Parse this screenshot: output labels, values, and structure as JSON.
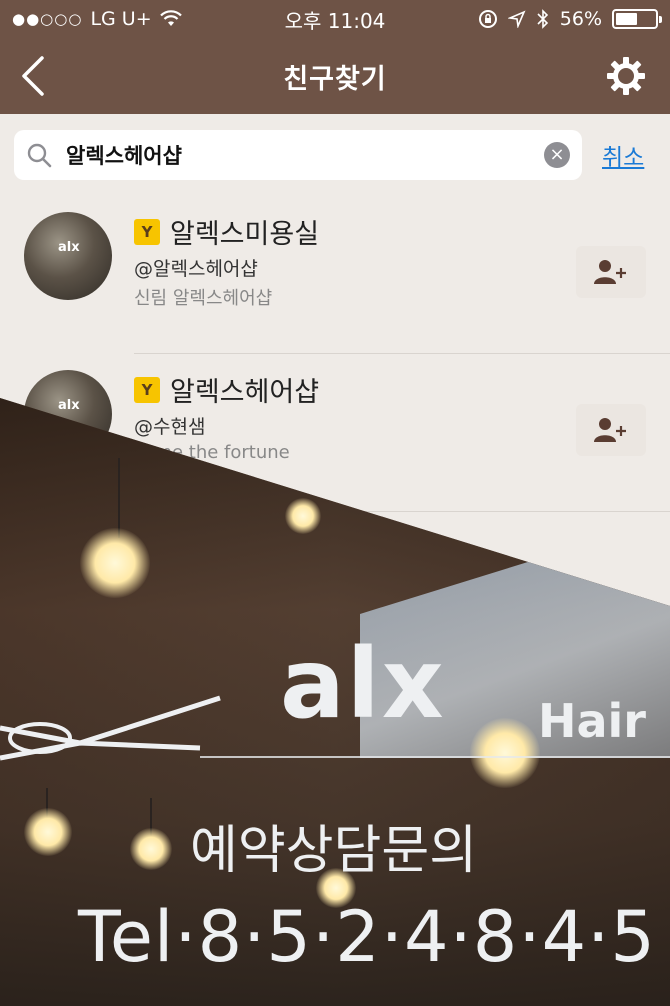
{
  "status": {
    "carrier": "LG U+",
    "time": "오후 11:04",
    "battery": "56%",
    "battery_level": 0.56
  },
  "nav": {
    "title": "친구찾기"
  },
  "search": {
    "value": "알렉스헤어샵",
    "cancel_label": "취소"
  },
  "results": [
    {
      "badge": "Y",
      "name": "알렉스미용실",
      "handle": "@알렉스헤어샵",
      "desc": "신림 알렉스헤어샵"
    },
    {
      "badge": "Y",
      "name": "알렉스헤어샵",
      "handle": "@수현샘",
      "desc": "w me the fortune"
    }
  ],
  "photo": {
    "logo_alx": "alx",
    "logo_hair": "Hair",
    "reservation": "예약상담문의",
    "tel": "Tel·8·5·2·4·8·4·5"
  },
  "colors": {
    "header_bg": "#6e5346",
    "page_bg": "#efebe7",
    "badge_yellow": "#f7c400",
    "link_blue": "#1a7ad6"
  }
}
